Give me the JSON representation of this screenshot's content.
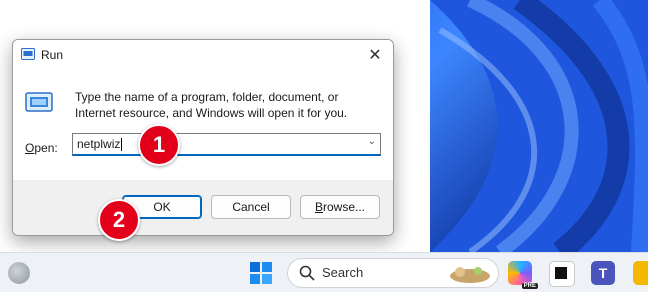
{
  "dialog": {
    "title": "Run",
    "description": "Type the name of a program, folder, document, or Internet resource, and Windows will open it for you.",
    "open_label_prefix": "O",
    "open_label_rest": "pen:",
    "input_value": "netplwiz",
    "buttons": {
      "ok": "OK",
      "cancel": "Cancel",
      "browse_prefix": "B",
      "browse_rest": "rowse..."
    }
  },
  "annotations": {
    "step1": "1",
    "step2": "2"
  },
  "taskbar": {
    "search_placeholder": "Search",
    "copilot_badge": "PRE"
  },
  "colors": {
    "accent": "#0067c0",
    "badge": "#e3001b",
    "wallpaper": "#1f5ee8"
  }
}
